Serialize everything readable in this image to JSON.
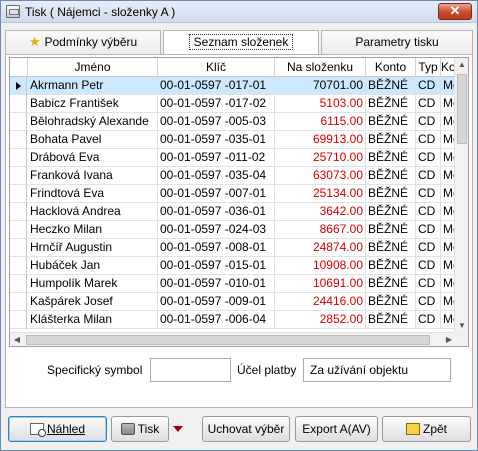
{
  "window": {
    "title": "Tisk ( Nájemci - složenky A )",
    "close_glyph": "✕"
  },
  "tabs": [
    {
      "label": "Podmínky výběru",
      "icon": "star-icon"
    },
    {
      "label": "Seznam složenek",
      "active": true
    },
    {
      "label": "Parametry tisku"
    }
  ],
  "grid": {
    "columns": [
      "Jméno",
      "Klíč",
      "Na složenku",
      "Konto",
      "Typ",
      "Ko"
    ],
    "rows": [
      {
        "name": "Akrmann Petr",
        "key": "00-01-0597 -017-01",
        "amount": "70701.00",
        "account": "BĚŽNÉ",
        "type": "CD",
        "ko": "Mě",
        "selected": true
      },
      {
        "name": "Babicz František",
        "key": "00-01-0597 -017-02",
        "amount": "5103.00",
        "account": "BĚŽNÉ",
        "type": "CD",
        "ko": "Mě"
      },
      {
        "name": "Bělohradský Alexande",
        "key": "00-01-0597 -005-03",
        "amount": "6115.00",
        "account": "BĚŽNÉ",
        "type": "CD",
        "ko": "Mě"
      },
      {
        "name": "Bohata Pavel",
        "key": "00-01-0597 -035-01",
        "amount": "69913.00",
        "account": "BĚŽNÉ",
        "type": "CD",
        "ko": "Mě"
      },
      {
        "name": "Drábová Eva",
        "key": "00-01-0597 -011-02",
        "amount": "25710.00",
        "account": "BĚŽNÉ",
        "type": "CD",
        "ko": "Mě"
      },
      {
        "name": "Franková Ivana",
        "key": "00-01-0597 -035-04",
        "amount": "63073.00",
        "account": "BĚŽNÉ",
        "type": "CD",
        "ko": "Mě"
      },
      {
        "name": "Frindtová Eva",
        "key": "00-01-0597 -007-01",
        "amount": "25134.00",
        "account": "BĚŽNÉ",
        "type": "CD",
        "ko": "Mě"
      },
      {
        "name": "Hacklová Andrea",
        "key": "00-01-0597 -036-01",
        "amount": "3642.00",
        "account": "BĚŽNÉ",
        "type": "CD",
        "ko": "Mě"
      },
      {
        "name": "Heczko Milan",
        "key": "00-01-0597 -024-03",
        "amount": "8667.00",
        "account": "BĚŽNÉ",
        "type": "CD",
        "ko": "Mě"
      },
      {
        "name": "Hrnčíř Augustin",
        "key": "00-01-0597 -008-01",
        "amount": "24874.00",
        "account": "BĚŽNÉ",
        "type": "CD",
        "ko": "Mě"
      },
      {
        "name": "Hubáček Jan",
        "key": "00-01-0597 -015-01",
        "amount": "10908.00",
        "account": "BĚŽNÉ",
        "type": "CD",
        "ko": "Mě"
      },
      {
        "name": "Humpolík Marek",
        "key": "00-01-0597 -010-01",
        "amount": "10691.00",
        "account": "BĚŽNÉ",
        "type": "CD",
        "ko": "Mě"
      },
      {
        "name": "Kašpárek Josef",
        "key": "00-01-0597 -009-01",
        "amount": "24416.00",
        "account": "BĚŽNÉ",
        "type": "CD",
        "ko": "Mě"
      },
      {
        "name": "Klášterka Milan",
        "key": "00-01-0597 -006-04",
        "amount": "2852.00",
        "account": "BĚŽNÉ",
        "type": "CD",
        "ko": "Mě"
      }
    ]
  },
  "form": {
    "specific_symbol_label": "Specifický symbol",
    "specific_symbol_value": "",
    "purpose_label": "Účel platby",
    "purpose_value": "Za užívání objektu"
  },
  "buttons": {
    "preview": "Náhled",
    "print": "Tisk",
    "keep_selection": "Uchovat výběr",
    "export": "Export A(AV)",
    "back": "Zpět"
  },
  "colors": {
    "selected_row": "#cce8ff",
    "amount_text": "#d60000",
    "window_border": "#6d8ab0"
  }
}
